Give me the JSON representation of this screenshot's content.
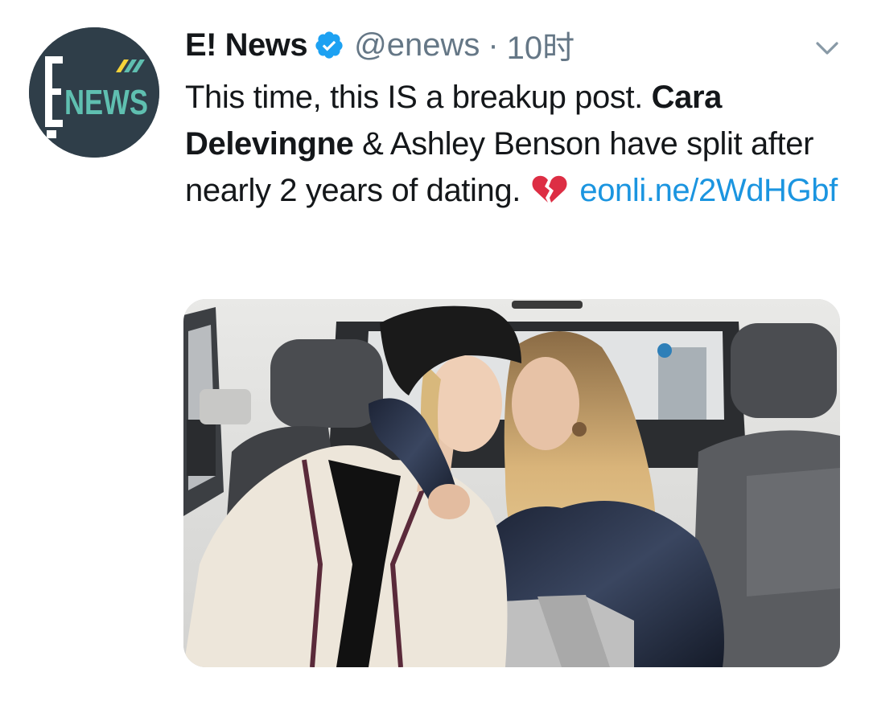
{
  "tweet": {
    "author": {
      "display_name": "E! News",
      "handle": "@enews",
      "verified": true,
      "avatar_icon": "enews-logo-icon",
      "avatar_text": "ENEWS"
    },
    "separator": "·",
    "time": "10时",
    "menu_icon": "chevron-down-icon",
    "text": {
      "part1": "This time, this IS a breakup post. ",
      "bold_name": "Cara Delevingne",
      "part2": " & Ashley Benson have split after nearly 2 years of dating. ",
      "emoji": "broken-heart-icon",
      "link": "eonli.ne/2WdHGbf"
    },
    "media": {
      "type": "photo",
      "description_icon": "photo-of-two-women-in-car"
    }
  },
  "colors": {
    "text": "#14171a",
    "secondary": "#657786",
    "link": "#1b95e0",
    "verified": "#1da1f2",
    "avatar_bg": "#2f3e49",
    "logo_accent": "#5fbfb0",
    "logo_yellow": "#f5d33a"
  }
}
